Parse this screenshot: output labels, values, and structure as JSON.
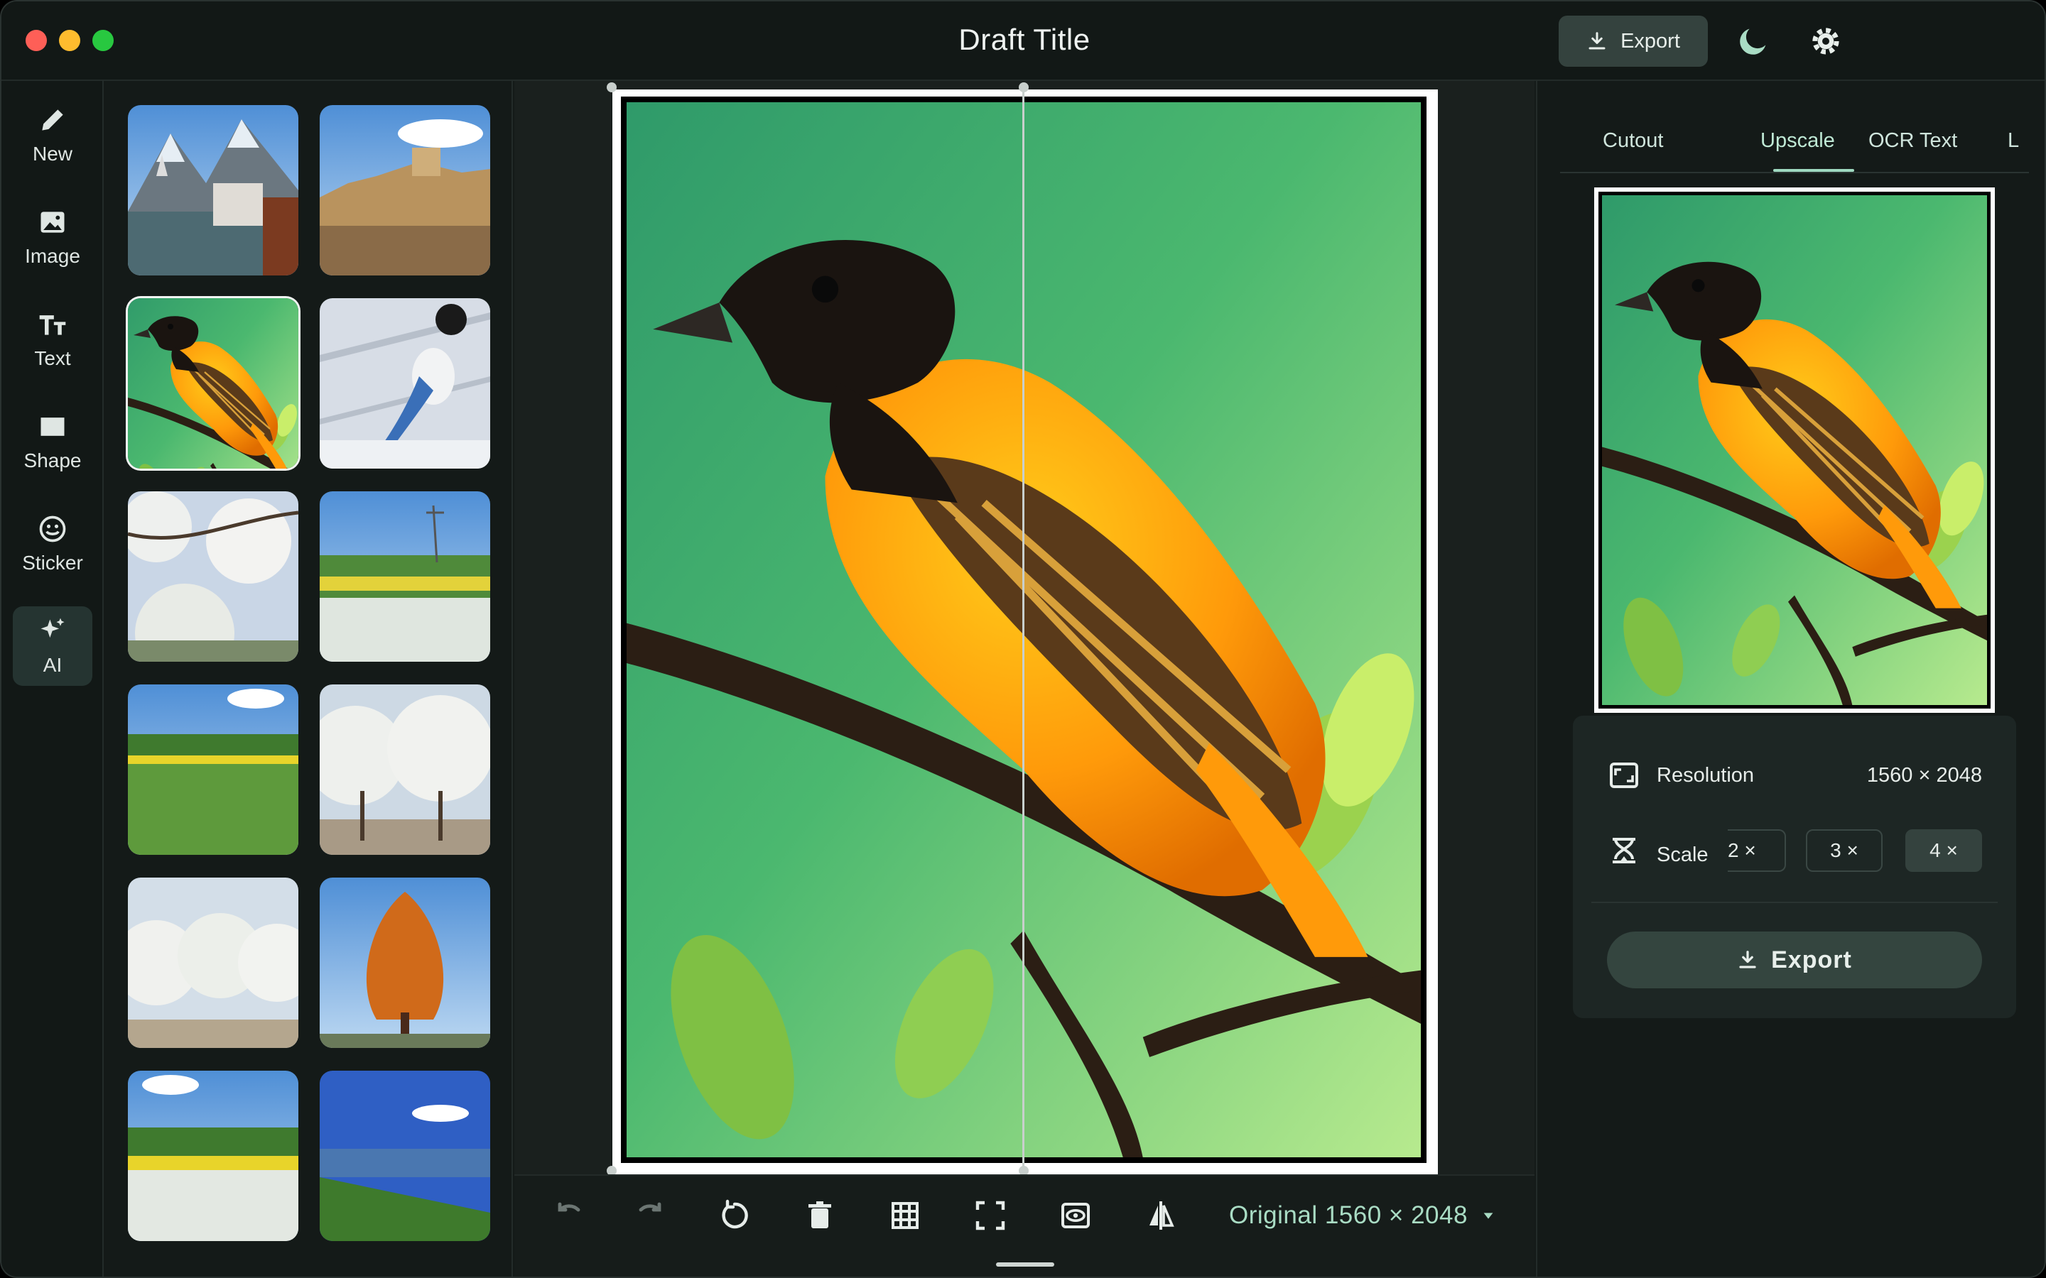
{
  "window": {
    "title": "Draft Title"
  },
  "titlebar": {
    "export_label": "Export"
  },
  "rail": {
    "items": [
      {
        "label": "New",
        "icon": "pencil-icon"
      },
      {
        "label": "Image",
        "icon": "image-icon"
      },
      {
        "label": "Text",
        "icon": "text-icon"
      },
      {
        "label": "Shape",
        "icon": "shape-icon"
      },
      {
        "label": "Sticker",
        "icon": "sticker-icon"
      },
      {
        "label": "AI",
        "icon": "sparkle-icon",
        "active": true
      }
    ]
  },
  "thumbnails": [
    {
      "subject": "mountain lakeside village"
    },
    {
      "subject": "castle over river"
    },
    {
      "subject": "orange bird on branch",
      "selected": true
    },
    {
      "subject": "blue magpie"
    },
    {
      "subject": "cherry blossom branches"
    },
    {
      "subject": "flower meadow with pylons"
    },
    {
      "subject": "green field with yellow flowers"
    },
    {
      "subject": "blossoming trees"
    },
    {
      "subject": "white blossom grove"
    },
    {
      "subject": "autumn orange tree"
    },
    {
      "subject": "daisy field"
    },
    {
      "subject": "lake shore"
    }
  ],
  "toolbar": {
    "resolution_label": "Original 1560 × 2048"
  },
  "right_panel": {
    "tabs": [
      "Cutout",
      "Upscale",
      "OCR Text",
      "L"
    ],
    "active_tab": "Upscale",
    "resolution_label": "Resolution",
    "resolution_value": "1560 × 2048",
    "scale_label": "Scale",
    "scale_options": [
      "2 ×",
      "3 ×",
      "4 ×"
    ],
    "selected_scale": "4 ×",
    "export_label": "Export"
  },
  "colors": {
    "accent": "#9fd9c0",
    "background": "#141a18",
    "button": "#34423e"
  }
}
